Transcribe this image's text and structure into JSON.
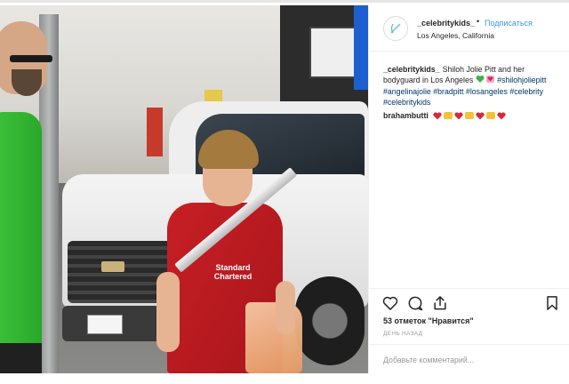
{
  "post": {
    "username": "_celebritykids_",
    "separator": "•",
    "follow_label": "Подписаться",
    "location": "Los Angeles, California",
    "caption_username": "_celebritykids_",
    "caption_text": "Shiloh Jolie Pitt and her bodyguard in Los Angeles",
    "caption_tags": "#shilohjoliepitt #angelinajolie #bradpitt #losangeles #celebrity #celebritykids",
    "photo_sponsor_text": "Standard Chartered",
    "comment_username": "brahambutti",
    "likes_text": "53 отметок \"Нравится\"",
    "time_text": "ДЕНЬ НАЗАД",
    "add_comment_placeholder": "Добавьте комментарий..."
  },
  "icons": {
    "like": "heart-icon",
    "comment": "comment-icon",
    "share": "share-icon",
    "save": "bookmark-icon"
  },
  "colors": {
    "link_blue": "#3897f0",
    "tag_blue": "#003569",
    "muted": "#999999"
  }
}
